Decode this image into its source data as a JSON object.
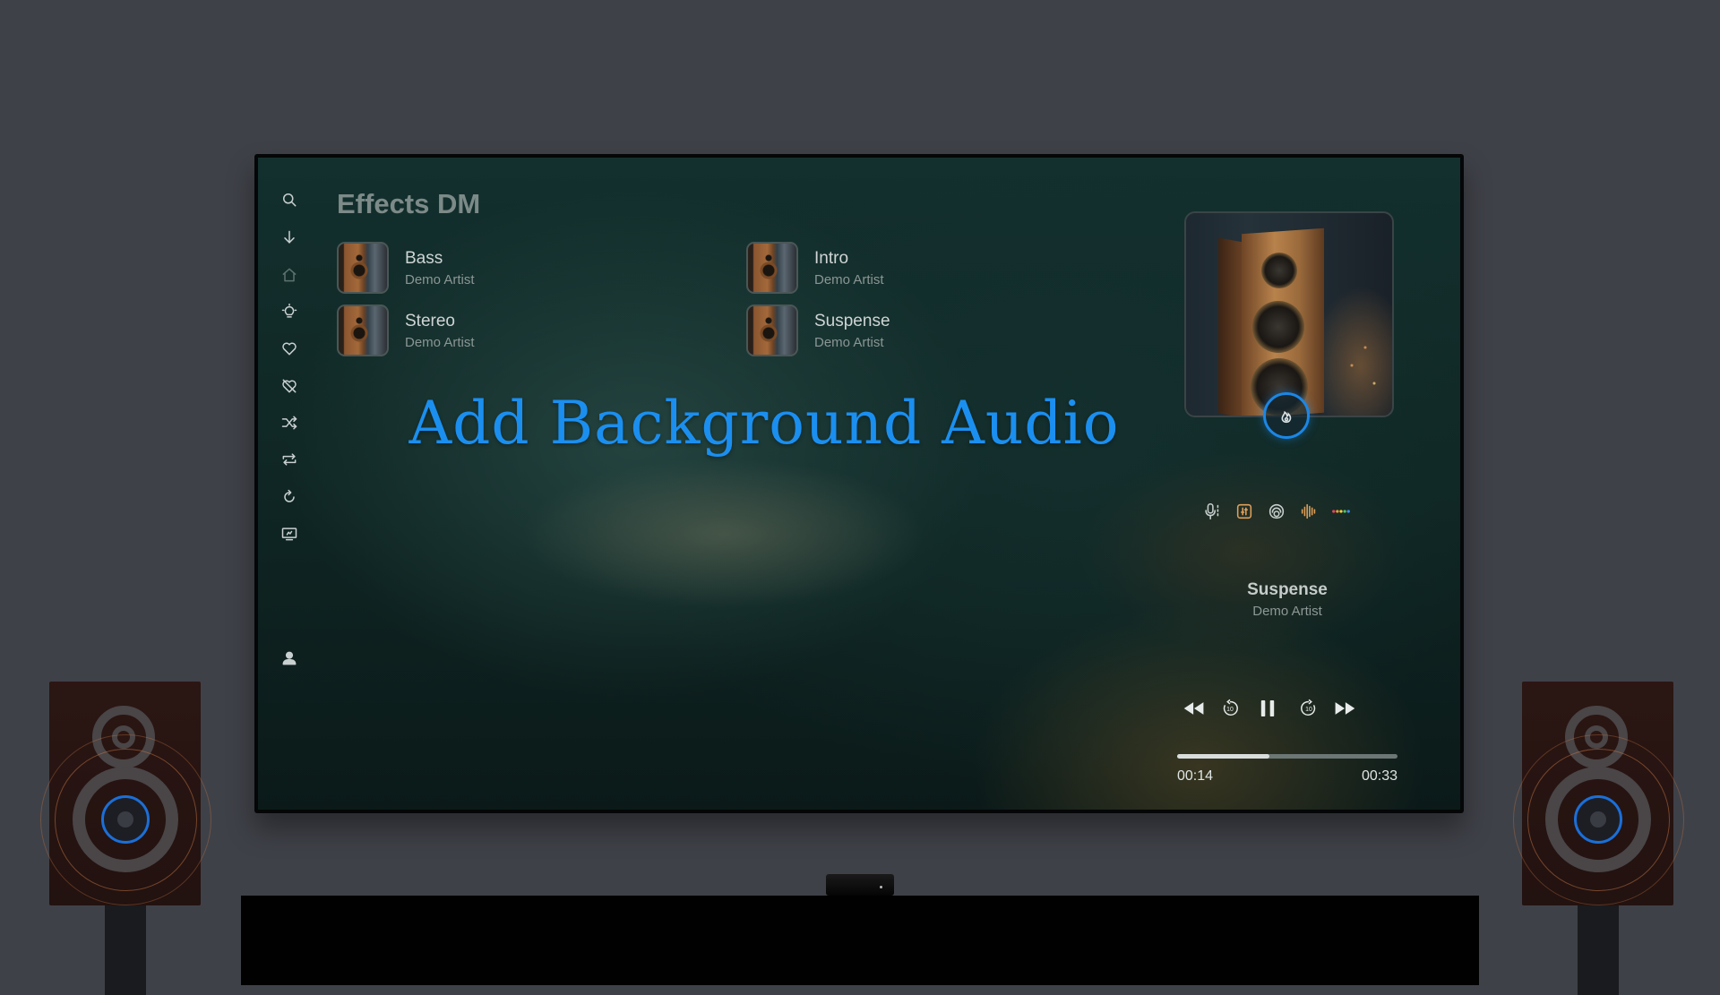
{
  "app": {
    "title": "Effects DM",
    "headline": "Add Background Audio"
  },
  "sidebar": {
    "items": [
      {
        "icon": "search-icon"
      },
      {
        "icon": "download-arrow-icon"
      },
      {
        "icon": "home-icon"
      },
      {
        "icon": "lightbulb-icon"
      },
      {
        "icon": "heart-icon"
      },
      {
        "icon": "heart-slash-icon"
      },
      {
        "icon": "shuffle-icon"
      },
      {
        "icon": "repeat-icon"
      },
      {
        "icon": "refresh-icon"
      },
      {
        "icon": "screen-icon"
      },
      {
        "icon": "profile-icon"
      }
    ]
  },
  "tracks": [
    {
      "title": "Bass",
      "artist": "Demo Artist"
    },
    {
      "title": "Intro",
      "artist": "Demo Artist"
    },
    {
      "title": "Stereo",
      "artist": "Demo Artist"
    },
    {
      "title": "Suspense",
      "artist": "Demo Artist"
    }
  ],
  "now_playing": {
    "title": "Suspense",
    "artist": "Demo Artist",
    "elapsed": "00:14",
    "total": "00:33",
    "progress": 0.42
  },
  "effects_icons": [
    "microphone-icon",
    "equalizer-icon",
    "surround-icon",
    "waveform-icon",
    "color-dots-icon"
  ],
  "colors": {
    "accent": "#1b8ff0",
    "background": "#3f4148"
  }
}
